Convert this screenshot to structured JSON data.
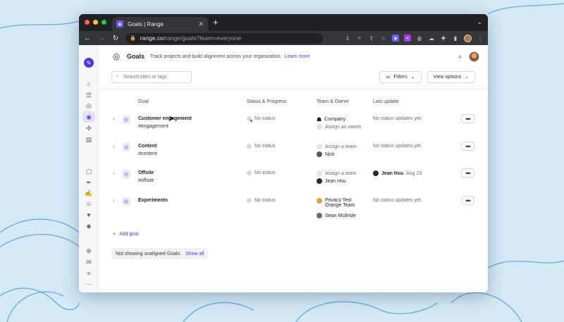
{
  "browser": {
    "tab_title": "Goals | Range",
    "url_host": "range.co",
    "url_path": "/range/goals?team=everyone"
  },
  "header": {
    "title": "Goals",
    "subtitle": "Track projects and build alignment across your organization.",
    "learn_more": "Learn more"
  },
  "filterbar": {
    "search_placeholder": "Search titles or tags",
    "filters_label": "Filters",
    "view_options_label": "View options"
  },
  "columns": {
    "goal": "Goal",
    "status": "Status & Progress",
    "team": "Team & Owner",
    "last_update": "Last update"
  },
  "goals": [
    {
      "name": "Customer engagement",
      "tag": "#engagement",
      "status": "No status",
      "team": "Company",
      "owner": "Assign an owner",
      "last_update": "No status updates yet."
    },
    {
      "name": "Content",
      "tag": "#content",
      "status": "No status",
      "team": "Assign a team",
      "owner": "Nick",
      "last_update": "No status updates yet."
    },
    {
      "name": "Offsite",
      "tag": "#offsite",
      "status": "No status",
      "team": "Assign a team",
      "owner": "Jean Hsu",
      "last_update_user": "Jean Hsu",
      "last_update_date": "Aug 23"
    },
    {
      "name": "Experiments",
      "tag": "",
      "status": "No status",
      "team": "Privacy Test Orange Team",
      "owner": "Sean McBride",
      "last_update": "No status updates yet."
    }
  ],
  "footer": {
    "add_goal": "Add goal",
    "notice": "Not showing unaligned Goals.",
    "show_all": "Show all"
  },
  "colors": {
    "accent": "#4b39e8",
    "background": "#d3e9f5"
  }
}
